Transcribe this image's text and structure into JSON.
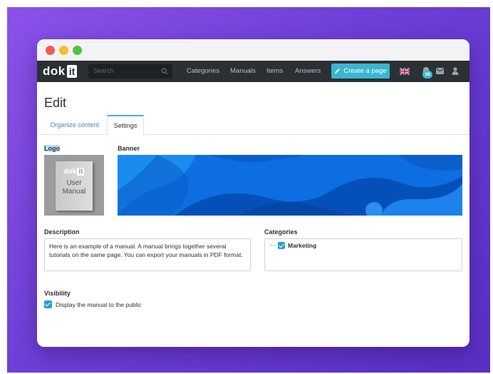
{
  "app": {
    "logo_part1": "dok",
    "logo_part2": "it"
  },
  "navbar": {
    "search_placeholder": "Search",
    "links": [
      "Categories",
      "Manuals",
      "Items",
      "Answers"
    ],
    "create_button": "Create a page",
    "notification_count": "38"
  },
  "page": {
    "title": "Edit"
  },
  "tabs": {
    "organize": "Organize content",
    "settings": "Settings"
  },
  "settings": {
    "logo_label": "Logo",
    "banner_label": "Banner",
    "logo_cover": {
      "brand1": "dok",
      "brand2": "it",
      "line1": "User",
      "line2": "Manual"
    },
    "description_label": "Description",
    "description_text": "Here is an example of a manual. A manual brings together several tutorials on the same page. You can export your manuals in PDF format.",
    "categories_label": "Categories",
    "category_item": "Marketing",
    "visibility_label": "Visibility",
    "visibility_option": "Display the manual to the public"
  },
  "colors": {
    "accent": "#39b6d1",
    "navbar": "#2b3035",
    "banner": "#0c6ee0",
    "background": "#6d3fd6"
  }
}
